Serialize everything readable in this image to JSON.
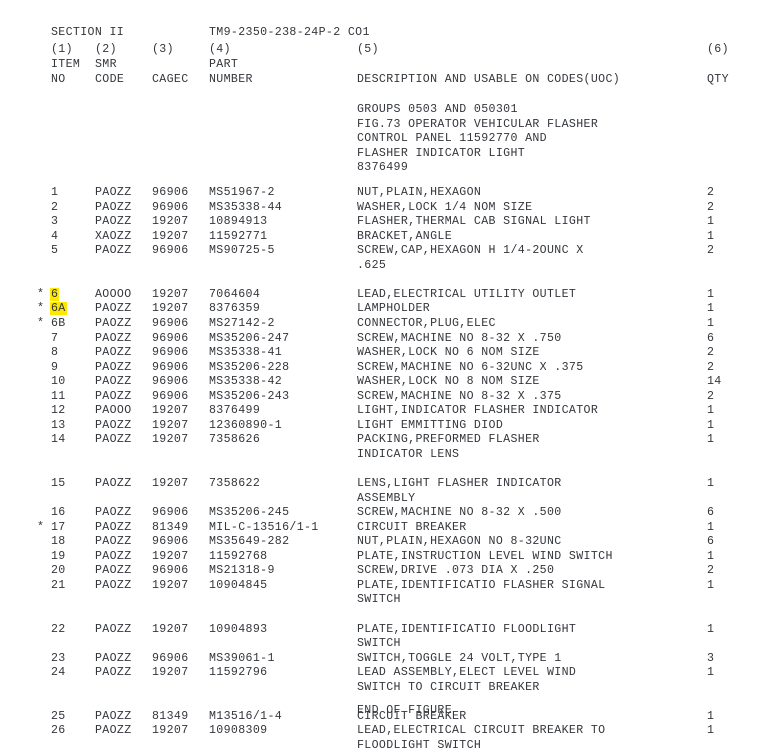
{
  "document": {
    "section": "SECTION II",
    "tm_number": "TM9-2350-238-24P-2 CO1",
    "end_of_figure": "END OF FIGURE"
  },
  "columns": {
    "numbers": [
      "(1)",
      "(2)",
      "(3)",
      "(4)",
      "(5)",
      "(6)"
    ],
    "item_no_line1": "ITEM",
    "item_no_line2": "NO",
    "smr_code_line1": "SMR",
    "smr_code_line2": "CODE",
    "cagec": "CAGEC",
    "part_line1": "PART",
    "part_line2": "NUMBER",
    "description": "DESCRIPTION AND USABLE ON CODES(UOC)",
    "qty": "QTY"
  },
  "figure_header": [
    "GROUPS 0503 AND 050301",
    "FIG.73 OPERATOR VEHICULAR FLASHER",
    "CONTROL PANEL 11592770 AND",
    "FLASHER INDICATOR LIGHT",
    "8376499"
  ],
  "highlight_color": "#ffe800",
  "rows": [
    {
      "star": "",
      "item": "1",
      "smr": "PAOZZ",
      "cagec": "96906",
      "part": "MS51967-2",
      "desc": [
        "NUT,PLAIN,HEXAGON"
      ],
      "qty": "2",
      "highlight": false
    },
    {
      "star": "",
      "item": "2",
      "smr": "PAOZZ",
      "cagec": "96906",
      "part": "MS35338-44",
      "desc": [
        "WASHER,LOCK 1/4 NOM SIZE"
      ],
      "qty": "2",
      "highlight": false
    },
    {
      "star": "",
      "item": "3",
      "smr": "PAOZZ",
      "cagec": "19207",
      "part": "10894913",
      "desc": [
        "FLASHER,THERMAL CAB SIGNAL LIGHT"
      ],
      "qty": "1",
      "highlight": false
    },
    {
      "star": "",
      "item": "4",
      "smr": "XAOZZ",
      "cagec": "19207",
      "part": "11592771",
      "desc": [
        "BRACKET,ANGLE"
      ],
      "qty": "1",
      "highlight": false
    },
    {
      "star": "",
      "item": "5",
      "smr": "PAOZZ",
      "cagec": "96906",
      "part": "MS90725-5",
      "desc": [
        "SCREW,CAP,HEXAGON H 1/4-2OUNC X",
        ".625"
      ],
      "qty": "2",
      "highlight": false
    },
    {
      "star": "*",
      "item": "6",
      "smr": "AOOOO",
      "cagec": "19207",
      "part": "7064604",
      "desc": [
        "LEAD,ELECTRICAL UTILITY OUTLET"
      ],
      "qty": "1",
      "highlight": true
    },
    {
      "star": "*",
      "item": "6A",
      "smr": "PAOZZ",
      "cagec": "19207",
      "part": "8376359",
      "desc": [
        "LAMPHOLDER"
      ],
      "qty": "1",
      "highlight": true
    },
    {
      "star": "*",
      "item": "6B",
      "smr": "PAOZZ",
      "cagec": "96906",
      "part": "MS27142-2",
      "desc": [
        "CONNECTOR,PLUG,ELEC"
      ],
      "qty": "1",
      "highlight": false
    },
    {
      "star": "",
      "item": "7",
      "smr": "PAOZZ",
      "cagec": "96906",
      "part": "MS35206-247",
      "desc": [
        "SCREW,MACHINE NO 8-32 X .750"
      ],
      "qty": "6",
      "highlight": false
    },
    {
      "star": "",
      "item": "8",
      "smr": "PAOZZ",
      "cagec": "96906",
      "part": "MS35338-41",
      "desc": [
        "WASHER,LOCK NO 6 NOM SIZE"
      ],
      "qty": "2",
      "highlight": false
    },
    {
      "star": "",
      "item": "9",
      "smr": "PAOZZ",
      "cagec": "96906",
      "part": "MS35206-228",
      "desc": [
        "SCREW,MACHINE NO 6-32UNC X .375"
      ],
      "qty": "2",
      "highlight": false
    },
    {
      "star": "",
      "item": "10",
      "smr": "PAOZZ",
      "cagec": "96906",
      "part": "MS35338-42",
      "desc": [
        "WASHER,LOCK NO 8 NOM SIZE"
      ],
      "qty": "14",
      "highlight": false
    },
    {
      "star": "",
      "item": "11",
      "smr": "PAOZZ",
      "cagec": "96906",
      "part": "MS35206-243",
      "desc": [
        "SCREW,MACHINE NO 8-32 X .375"
      ],
      "qty": "2",
      "highlight": false
    },
    {
      "star": "",
      "item": "12",
      "smr": "PAOOO",
      "cagec": "19207",
      "part": "8376499",
      "desc": [
        "LIGHT,INDICATOR FLASHER INDICATOR"
      ],
      "qty": "1",
      "highlight": false
    },
    {
      "star": "",
      "item": "13",
      "smr": "PAOZZ",
      "cagec": "19207",
      "part": "12360890-1",
      "desc": [
        "LIGHT EMMITTING DIOD"
      ],
      "qty": "1",
      "highlight": false
    },
    {
      "star": "",
      "item": "14",
      "smr": "PAOZZ",
      "cagec": "19207",
      "part": "7358626",
      "desc": [
        "PACKING,PREFORMED FLASHER",
        "INDICATOR LENS"
      ],
      "qty": "1",
      "highlight": false
    },
    {
      "star": "",
      "item": "15",
      "smr": "PAOZZ",
      "cagec": "19207",
      "part": "7358622",
      "desc": [
        "LENS,LIGHT FLASHER INDICATOR",
        "ASSEMBLY"
      ],
      "qty": "1",
      "highlight": false
    },
    {
      "star": "",
      "item": "16",
      "smr": "PAOZZ",
      "cagec": "96906",
      "part": "MS35206-245",
      "desc": [
        "SCREW,MACHINE NO 8-32 X .500"
      ],
      "qty": "6",
      "highlight": false
    },
    {
      "star": "*",
      "item": "17",
      "smr": "PAOZZ",
      "cagec": "81349",
      "part": "MIL-C-13516/1-1",
      "desc": [
        "CIRCUIT BREAKER"
      ],
      "qty": "1",
      "highlight": false
    },
    {
      "star": "",
      "item": "18",
      "smr": "PAOZZ",
      "cagec": "96906",
      "part": "MS35649-282",
      "desc": [
        "NUT,PLAIN,HEXAGON NO 8-32UNC"
      ],
      "qty": "6",
      "highlight": false
    },
    {
      "star": "",
      "item": "19",
      "smr": "PAOZZ",
      "cagec": "19207",
      "part": "11592768",
      "desc": [
        "PLATE,INSTRUCTION LEVEL WIND SWITCH"
      ],
      "qty": "1",
      "highlight": false
    },
    {
      "star": "",
      "item": "20",
      "smr": "PAOZZ",
      "cagec": "96906",
      "part": "MS21318-9",
      "desc": [
        "SCREW,DRIVE .073 DIA X .250"
      ],
      "qty": "2",
      "highlight": false
    },
    {
      "star": "",
      "item": "21",
      "smr": "PAOZZ",
      "cagec": "19207",
      "part": "10904845",
      "desc": [
        "PLATE,IDENTIFICATIO FLASHER SIGNAL",
        "SWITCH"
      ],
      "qty": "1",
      "highlight": false
    },
    {
      "star": "",
      "item": "22",
      "smr": "PAOZZ",
      "cagec": "19207",
      "part": "10904893",
      "desc": [
        "PLATE,IDENTIFICATIO FLOODLIGHT",
        "SWITCH"
      ],
      "qty": "1",
      "highlight": false
    },
    {
      "star": "",
      "item": "23",
      "smr": "PAOZZ",
      "cagec": "96906",
      "part": "MS39061-1",
      "desc": [
        "SWITCH,TOGGLE 24 VOLT,TYPE 1"
      ],
      "qty": "3",
      "highlight": false
    },
    {
      "star": "",
      "item": "24",
      "smr": "PAOZZ",
      "cagec": "19207",
      "part": "11592796",
      "desc": [
        "LEAD ASSEMBLY,ELECT LEVEL WIND",
        "SWITCH TO CIRCUIT BREAKER"
      ],
      "qty": "1",
      "highlight": false
    },
    {
      "star": "",
      "item": "25",
      "smr": "PAOZZ",
      "cagec": "81349",
      "part": "M13516/1-4",
      "desc": [
        "CIRCUIT BREAKER"
      ],
      "qty": "1",
      "highlight": false
    },
    {
      "star": "",
      "item": "26",
      "smr": "PAOZZ",
      "cagec": "19207",
      "part": "10908309",
      "desc": [
        "LEAD,ELECTRICAL CIRCUIT BREAKER TO",
        "FLOODLIGHT SWITCH"
      ],
      "qty": "1",
      "highlight": false
    }
  ]
}
